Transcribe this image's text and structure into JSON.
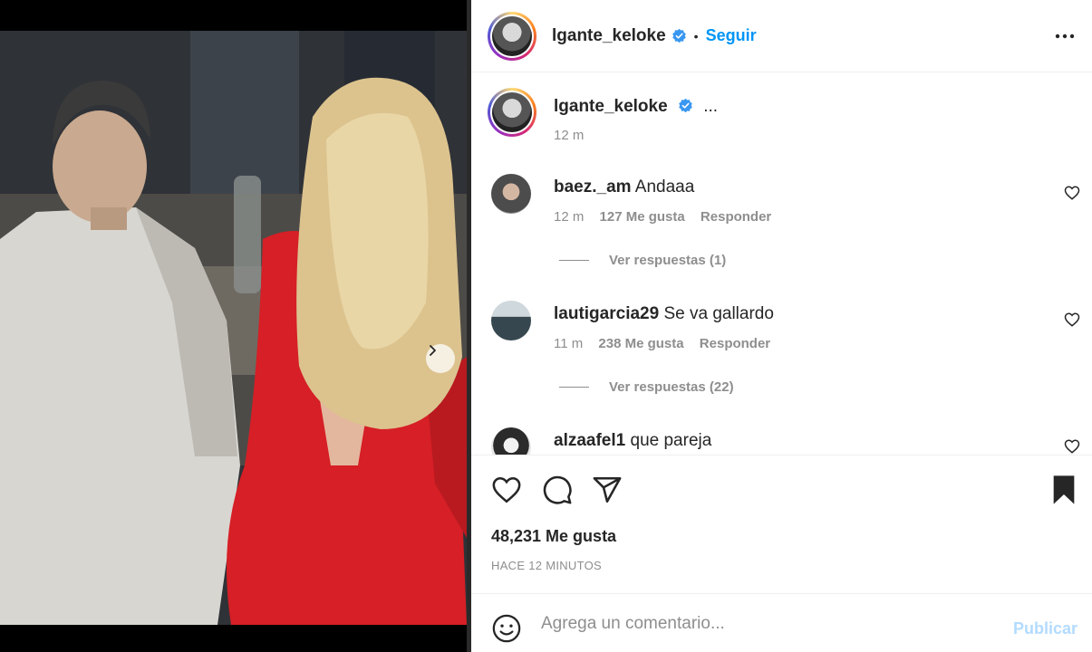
{
  "post": {
    "username": "lgante_keloke",
    "follow_label": "Seguir",
    "separator": "•",
    "caption_ellipsis": "...",
    "caption_time": "12 m",
    "likes_text": "48,231 Me gusta",
    "posted_ago": "HACE 12 MINUTOS"
  },
  "comments": [
    {
      "username": "baez._am",
      "text": "Andaaa",
      "time": "12 m",
      "likes": "127 Me gusta",
      "reply_label": "Responder",
      "view_replies": "Ver respuestas (1)"
    },
    {
      "username": "lautigarcia29",
      "text": "Se va gallardo",
      "time": "11 m",
      "likes": "238 Me gusta",
      "reply_label": "Responder",
      "view_replies": "Ver respuestas (22)"
    },
    {
      "username": "alzaafel1",
      "text": "que pareja"
    }
  ],
  "composer": {
    "placeholder": "Agrega un comentario...",
    "publish_label": "Publicar"
  },
  "colors": {
    "accent": "#0095f6",
    "muted": "#8e8e8e",
    "publish_disabled": "#b3dbff",
    "dress": "#d61f26"
  },
  "icons": [
    "verified-icon",
    "more-options-icon",
    "heart-icon",
    "comment-icon",
    "share-icon",
    "bookmark-icon",
    "emoji-icon",
    "chevron-right-icon"
  ],
  "carousel": {
    "count": 2,
    "active": 1
  }
}
